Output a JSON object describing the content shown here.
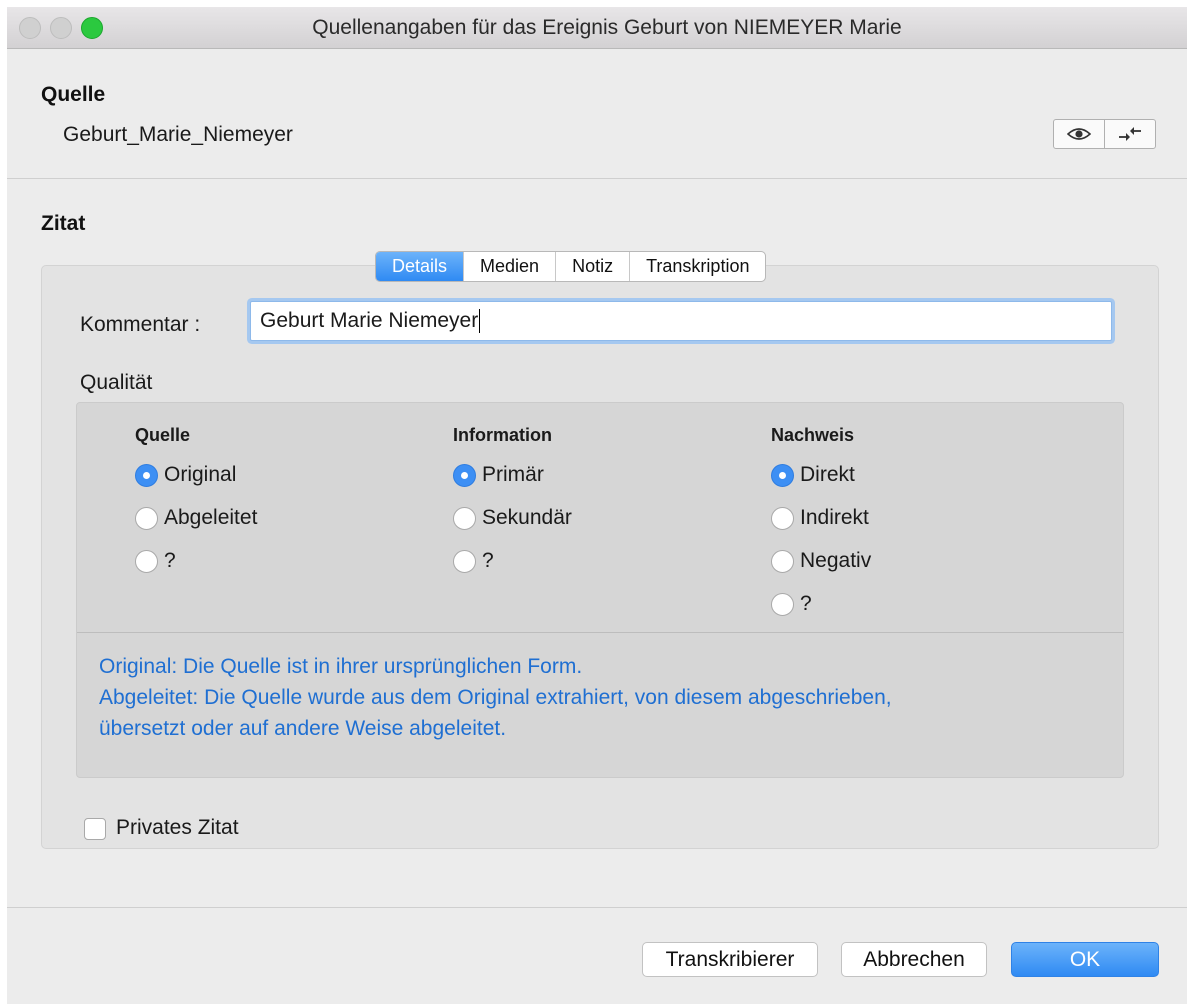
{
  "window": {
    "title": "Quellenangaben für das Ereignis Geburt von NIEMEYER Marie"
  },
  "source": {
    "heading": "Quelle",
    "value": "Geburt_Marie_Niemeyer",
    "icons": [
      "eye-icon",
      "swap-arrows-icon"
    ]
  },
  "citation": {
    "heading": "Zitat",
    "tabs": [
      {
        "label": "Details",
        "active": true
      },
      {
        "label": "Medien",
        "active": false
      },
      {
        "label": "Notiz",
        "active": false
      },
      {
        "label": "Transkription",
        "active": false
      }
    ],
    "comment_label": "Kommentar :",
    "comment_value": "Geburt Marie Niemeyer",
    "quality_label": "Qualität",
    "quality": {
      "quelle": {
        "heading": "Quelle",
        "options": [
          "Original",
          "Abgeleitet",
          "?"
        ],
        "selected": "Original"
      },
      "information": {
        "heading": "Information",
        "options": [
          "Primär",
          "Sekundär",
          "?"
        ],
        "selected": "Primär"
      },
      "nachweis": {
        "heading": "Nachweis",
        "options": [
          "Direkt",
          "Indirekt",
          "Negativ",
          "?"
        ],
        "selected": "Direkt"
      }
    },
    "info_lines": [
      "Original: Die Quelle ist in ihrer ursprünglichen Form.",
      "Abgeleitet: Die Quelle wurde aus dem Original extrahiert, von diesem abgeschrieben,",
      "übersetzt oder auf andere Weise abgeleitet."
    ],
    "private_label": "Privates Zitat",
    "private_checked": false
  },
  "buttons": {
    "transcriber": "Transkribierer",
    "cancel": "Abbrechen",
    "ok": "OK"
  },
  "colors": {
    "accent": "#2f8af3",
    "info_text": "#1f6fd2",
    "zoom_button": "#2bc93f"
  }
}
